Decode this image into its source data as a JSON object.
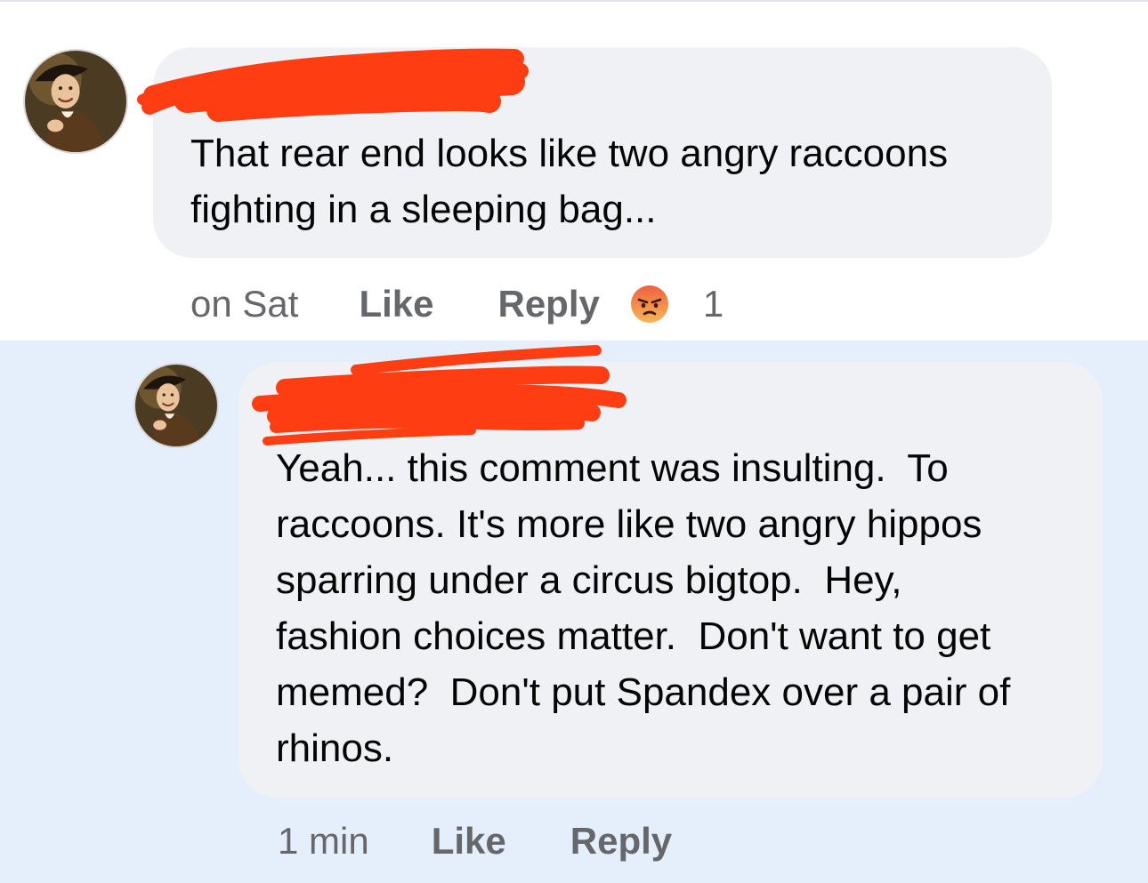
{
  "colors": {
    "bubble": "#f0f1f5",
    "highlight": "#e5effc",
    "meta_text": "#65676b",
    "redaction_marker": "#ff3d12",
    "angry_reaction": "#f0613c"
  },
  "comments": [
    {
      "author": "",
      "author_redacted": true,
      "avatar_icon": "profile-portrait-avatar",
      "text": "That rear end looks like two angry raccoons\nfighting in a sleeping bag...",
      "time": "on Sat",
      "like_label": "Like",
      "reply_label": "Reply",
      "reaction_icon": "angry-reaction-icon",
      "reaction_count": "1"
    },
    {
      "author": "",
      "author_redacted": true,
      "avatar_icon": "profile-portrait-avatar",
      "highlighted": true,
      "text": "Yeah... this comment was insulting.  To\nraccoons. It's more like two angry hippos\nsparring under a circus bigtop.  Hey,\nfashion choices matter.  Don't want to get\nmemed?  Don't put Spandex over a pair of\nrhinos.",
      "time": "1 min",
      "like_label": "Like",
      "reply_label": "Reply"
    }
  ]
}
